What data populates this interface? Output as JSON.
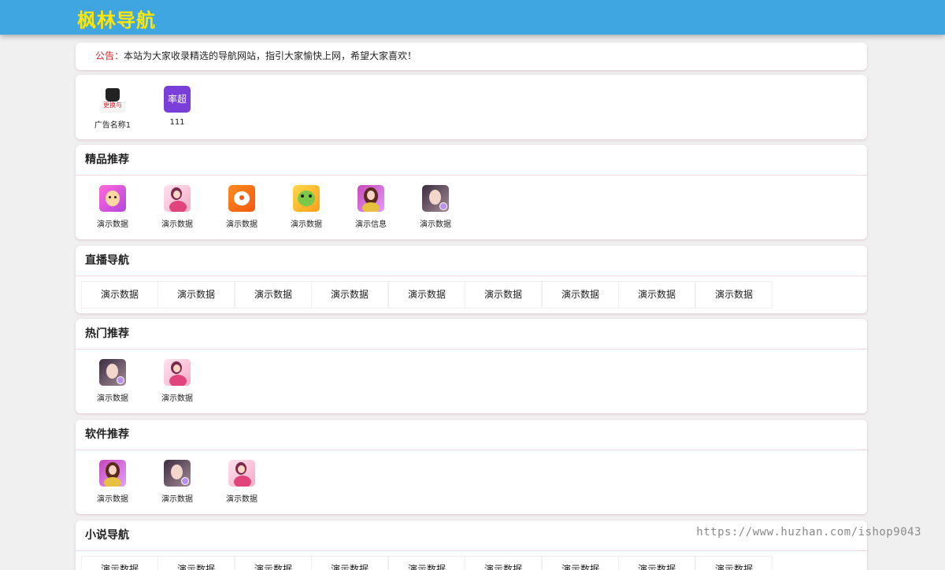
{
  "header": {
    "title": "枫林导航"
  },
  "notice": {
    "label": "公告：",
    "text": "本站为大家收录精选的导航网站，指引大家愉快上网，希望大家喜欢！"
  },
  "ads": [
    {
      "label": "广告名称1",
      "icon": "bag-ad-icon",
      "icon_text": "更换与"
    },
    {
      "label": "111",
      "icon": "purple-ad-icon",
      "icon_text": "率超"
    }
  ],
  "sections": {
    "featured": {
      "title": "精品推荐",
      "items": [
        {
          "label": "演示数据",
          "icon": "deer-app-icon"
        },
        {
          "label": "演示数据",
          "icon": "pink-girl-app-icon"
        },
        {
          "label": "演示数据",
          "icon": "fox-app-icon"
        },
        {
          "label": "演示数据",
          "icon": "dragon-app-icon"
        },
        {
          "label": "演示信息",
          "icon": "purple-girl-app-icon"
        },
        {
          "label": "演示数据",
          "icon": "photo-girl-app-icon"
        }
      ]
    },
    "live": {
      "title": "直播导航",
      "links": [
        "演示数据",
        "演示数据",
        "演示数据",
        "演示数据",
        "演示数据",
        "演示数据",
        "演示数据",
        "演示数据",
        "演示数据"
      ]
    },
    "hot": {
      "title": "热门推荐",
      "items": [
        {
          "label": "演示数据",
          "icon": "photo-girl-app-icon"
        },
        {
          "label": "演示数据",
          "icon": "pink-girl-app-icon"
        }
      ]
    },
    "software": {
      "title": "软件推荐",
      "items": [
        {
          "label": "演示数据",
          "icon": "purple-girl-app-icon"
        },
        {
          "label": "演示数据",
          "icon": "photo-girl-app-icon"
        },
        {
          "label": "演示数据",
          "icon": "pink-girl-app-icon"
        }
      ]
    },
    "novel": {
      "title": "小说导航",
      "links": [
        "演示数据",
        "演示数据",
        "演示数据",
        "演示数据",
        "演示数据",
        "演示数据",
        "演示数据",
        "演示数据",
        "演示数据"
      ]
    }
  },
  "watermark": "https://www.huzhan.com/ishop9043",
  "colors": {
    "header_bg": "#3fa6e2",
    "logo": "#ffe600",
    "notice_label": "#d9242a"
  }
}
